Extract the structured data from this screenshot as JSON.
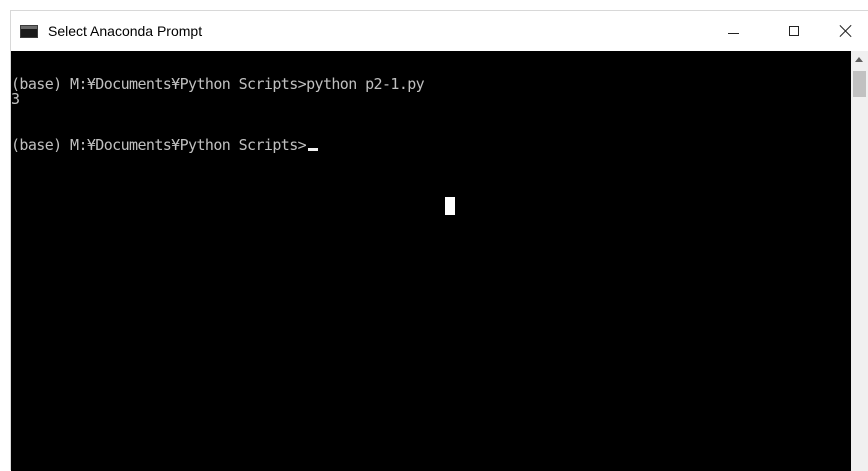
{
  "window": {
    "title": "Select Anaconda Prompt",
    "controls": {
      "minimize_icon": "minimize-icon",
      "maximize_icon": "maximize-icon",
      "close_icon": "close-icon"
    }
  },
  "console": {
    "lines": [
      "(base) M:¥Documents¥Python Scripts>python p2-1.py",
      "3",
      "(base) M:¥Documents¥Python Scripts>"
    ],
    "background_color": "#000000",
    "text_color": "#c0c0c0"
  }
}
